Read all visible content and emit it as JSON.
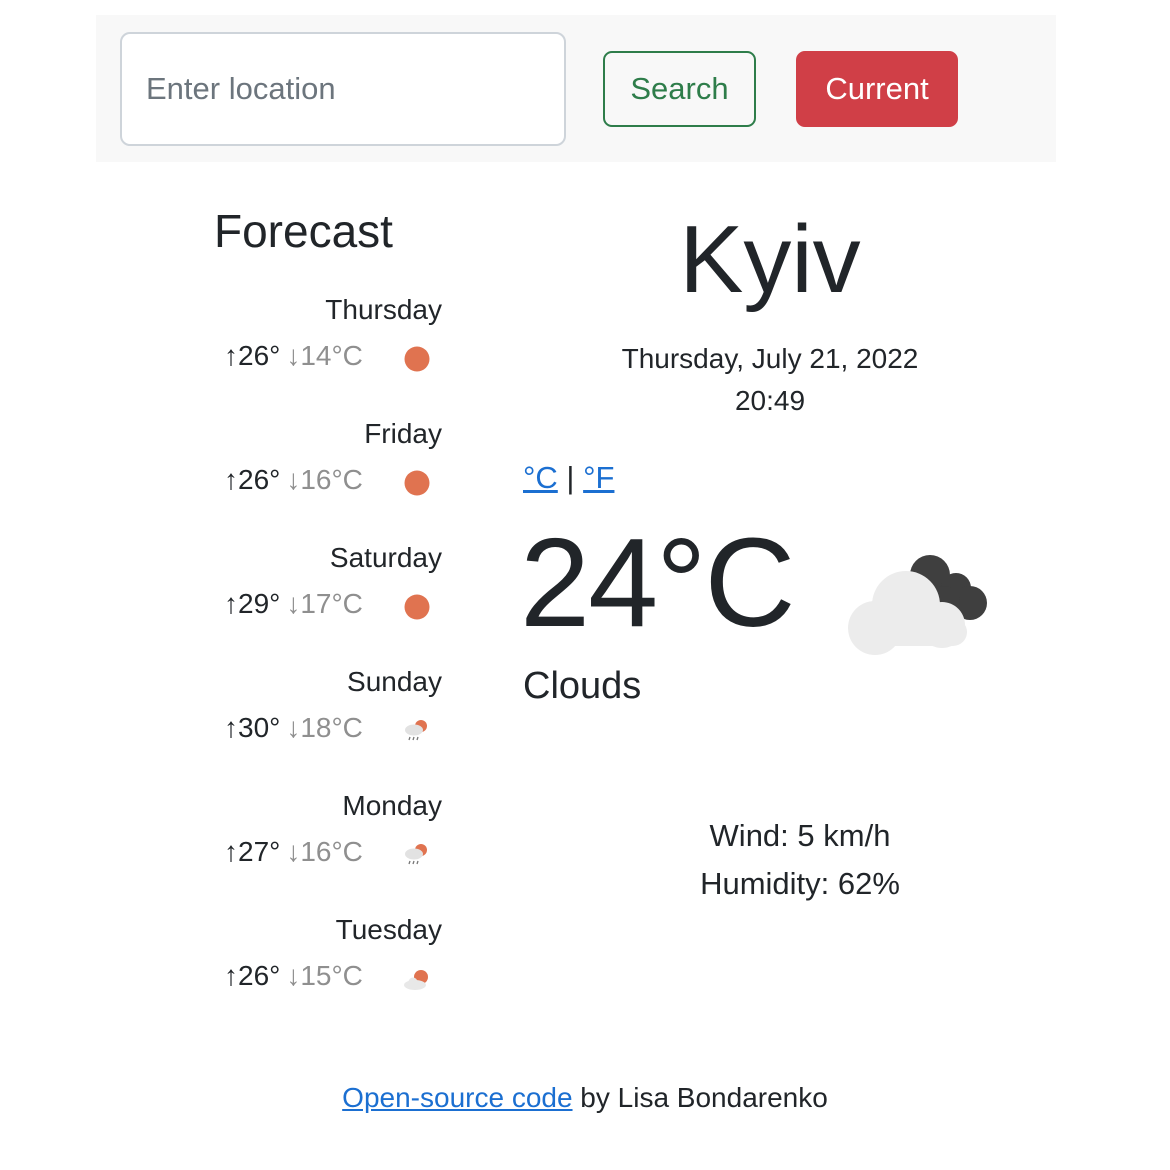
{
  "search": {
    "placeholder": "Enter location",
    "search_label": "Search",
    "current_label": "Current"
  },
  "forecast": {
    "title": "Forecast",
    "days": [
      {
        "day": "Thursday",
        "max": "↑26°",
        "min": "↓14°C",
        "icon": "sun-icon"
      },
      {
        "day": "Friday",
        "max": "↑26°",
        "min": "↓16°C",
        "icon": "sun-icon"
      },
      {
        "day": "Saturday",
        "max": "↑29°",
        "min": "↓17°C",
        "icon": "sun-icon"
      },
      {
        "day": "Sunday",
        "max": "↑30°",
        "min": "↓18°C",
        "icon": "rain-icon"
      },
      {
        "day": "Monday",
        "max": "↑27°",
        "min": "↓16°C",
        "icon": "rain-icon"
      },
      {
        "day": "Tuesday",
        "max": "↑26°",
        "min": "↓15°C",
        "icon": "partly-cloudy-icon"
      }
    ]
  },
  "current": {
    "city": "Kyiv",
    "date": "Thursday, July 21, 2022",
    "time": "20:49",
    "unit_c": "°C",
    "unit_sep": "|",
    "unit_f": "°F",
    "temperature": "24°C",
    "condition": "Clouds",
    "wind": "Wind: 5 km/h",
    "humidity": "Humidity: 62%",
    "icon": "broken-clouds-icon"
  },
  "footer": {
    "link_label": "Open-source code",
    "suffix": " by Lisa Bondarenko"
  },
  "colors": {
    "search_green": "#2e7d4a",
    "current_red": "#d03f47",
    "sun": "#e07350",
    "link": "#1b6fd1"
  }
}
